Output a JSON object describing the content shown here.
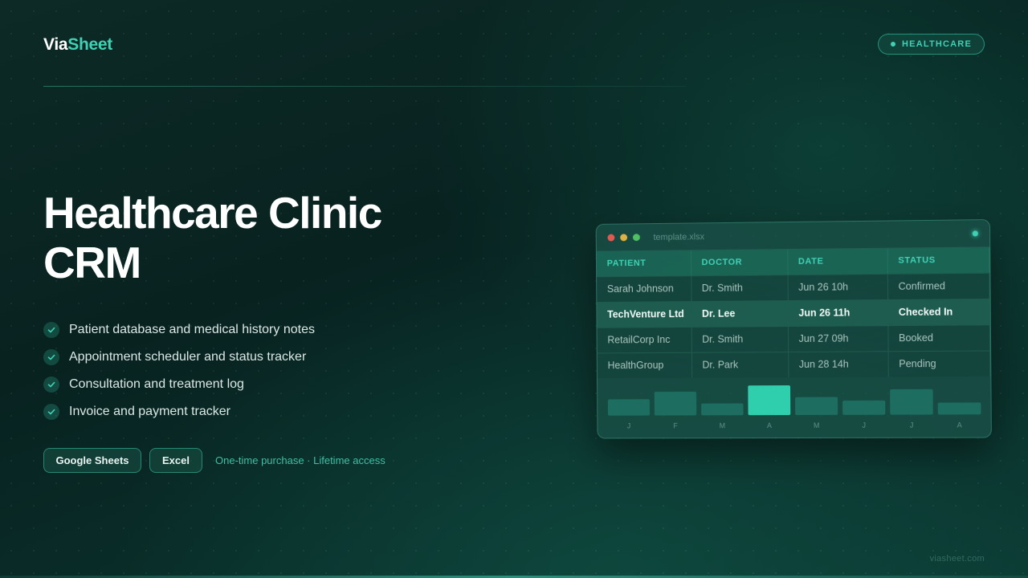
{
  "brand": {
    "part1": "Via",
    "part2": "Sheet"
  },
  "tag": {
    "label": "HEALTHCARE"
  },
  "hero": {
    "title_line1": "Healthcare Clinic",
    "title_line2": "CRM"
  },
  "features": [
    "Patient database and medical history notes",
    "Appointment scheduler and status tracker",
    "Consultation and treatment log",
    "Invoice and payment tracker"
  ],
  "platforms": {
    "google_sheets": "Google Sheets",
    "excel": "Excel"
  },
  "purchase_note": "One-time purchase · Lifetime access",
  "footer": {
    "site": "viasheet.com"
  },
  "preview": {
    "filename": "template.xlsx",
    "columns": [
      "PATIENT",
      "DOCTOR",
      "DATE",
      "STATUS"
    ],
    "rows": [
      [
        "Sarah Johnson",
        "Dr. Smith",
        "Jun 26 10h",
        "Confirmed"
      ],
      [
        "TechVenture Ltd",
        "Dr. Lee",
        "Jun 26 11h",
        "Checked In"
      ],
      [
        "RetailCorp Inc",
        "Dr. Smith",
        "Jun 27 09h",
        "Booked"
      ],
      [
        "HealthGroup",
        "Dr. Park",
        "Jun 28 14h",
        "Pending"
      ]
    ],
    "highlighted_row": 1
  },
  "chart_data": {
    "type": "bar",
    "categories": [
      "J",
      "F",
      "M",
      "A",
      "M",
      "J",
      "J",
      "A"
    ],
    "values": [
      0.55,
      0.8,
      0.4,
      1.0,
      0.6,
      0.48,
      0.85,
      0.4
    ],
    "highlight_index": 3,
    "colors": {
      "bar": "#1d6e60",
      "highlight": "#2fcfae",
      "label": "#5f8f86"
    }
  },
  "colors": {
    "accent": "#3fd1b4",
    "background": "#082220"
  }
}
